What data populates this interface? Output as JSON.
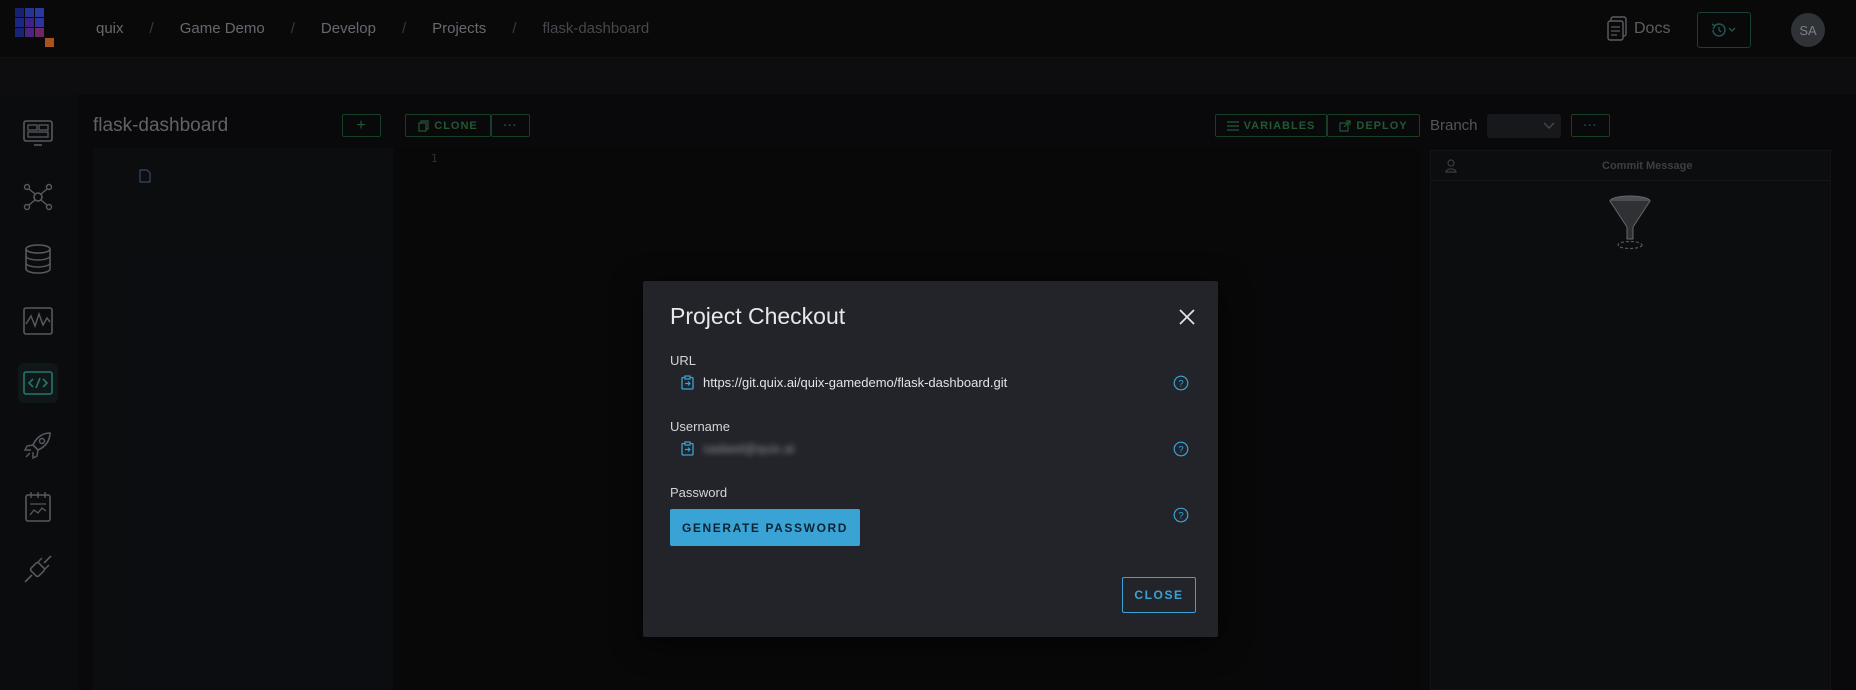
{
  "breadcrumbs": [
    "quix",
    "Game Demo",
    "Develop",
    "Projects",
    "flask-dashboard"
  ],
  "header": {
    "docs_label": "Docs",
    "avatar_initials": "SA"
  },
  "workspace": {
    "project_title": "flask-dashboard",
    "add_label": "+",
    "clone_label": "CLONE",
    "more_label": "···",
    "variables_label": "VARIABLES",
    "deploy_label": "DEPLOY",
    "branch_label": "Branch",
    "branch_more_label": "···",
    "line_number": "1",
    "commit_message_header": "Commit Message"
  },
  "nav_icons": [
    "monitor-icon",
    "pipeline-icon",
    "database-icon",
    "waveform-icon",
    "code-icon",
    "rocket-icon",
    "notebook-icon",
    "plug-icon"
  ],
  "modal": {
    "title": "Project Checkout",
    "url_label": "URL",
    "url_value": "https://git.quix.ai/quix-gamedemo/flask-dashboard.git",
    "username_label": "Username",
    "username_value": "sadawl@quix.ai",
    "password_label": "Password",
    "generate_label": "GENERATE PASSWORD",
    "close_label": "CLOSE"
  },
  "colors": {
    "accent": "#3aa3d6",
    "modal_bg": "#222429",
    "toolbar_green": "#2d6b3d",
    "page_bg": "#0c0c0e"
  }
}
